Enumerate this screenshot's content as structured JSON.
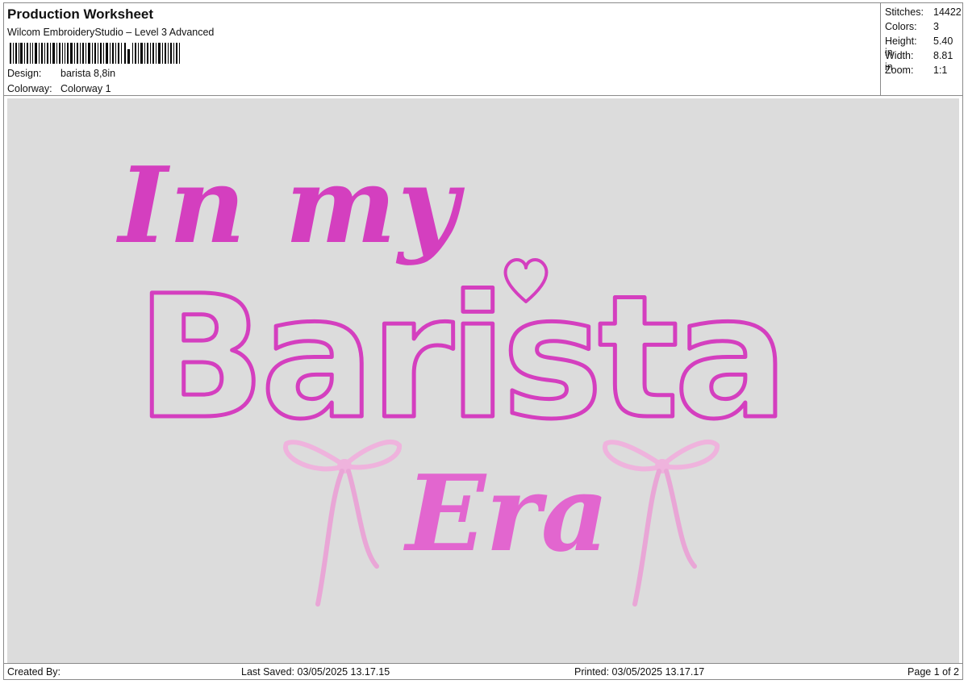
{
  "header": {
    "title": "Production Worksheet",
    "subtitle": "Wilcom EmbroideryStudio – Level 3 Advanced",
    "design_label": "Design:",
    "design_value": "barista 8,8in",
    "colorway_label": "Colorway:",
    "colorway_value": "Colorway 1"
  },
  "stats": {
    "stitches_label": "Stitches:",
    "stitches_value": "14422",
    "colors_label": "Colors:",
    "colors_value": "3",
    "height_label": "Height:",
    "height_value": "5.40 in",
    "width_label": "Width:",
    "width_value": "8.81 in",
    "zoom_label": "Zoom:",
    "zoom_value": "1:1"
  },
  "design": {
    "line1": "In my",
    "line2": "Barista",
    "line3": "Era",
    "colors": {
      "magenta": "#d43fbf",
      "pink": "#e98fd6",
      "light_pink": "#efb3dd",
      "canvas": "#dcdcdc"
    }
  },
  "footer": {
    "created": "Created By:",
    "saved": "Last Saved: 03/05/2025 13.17.15",
    "printed": "Printed: 03/05/2025 13.17.17",
    "page": "Page 1 of 2"
  }
}
